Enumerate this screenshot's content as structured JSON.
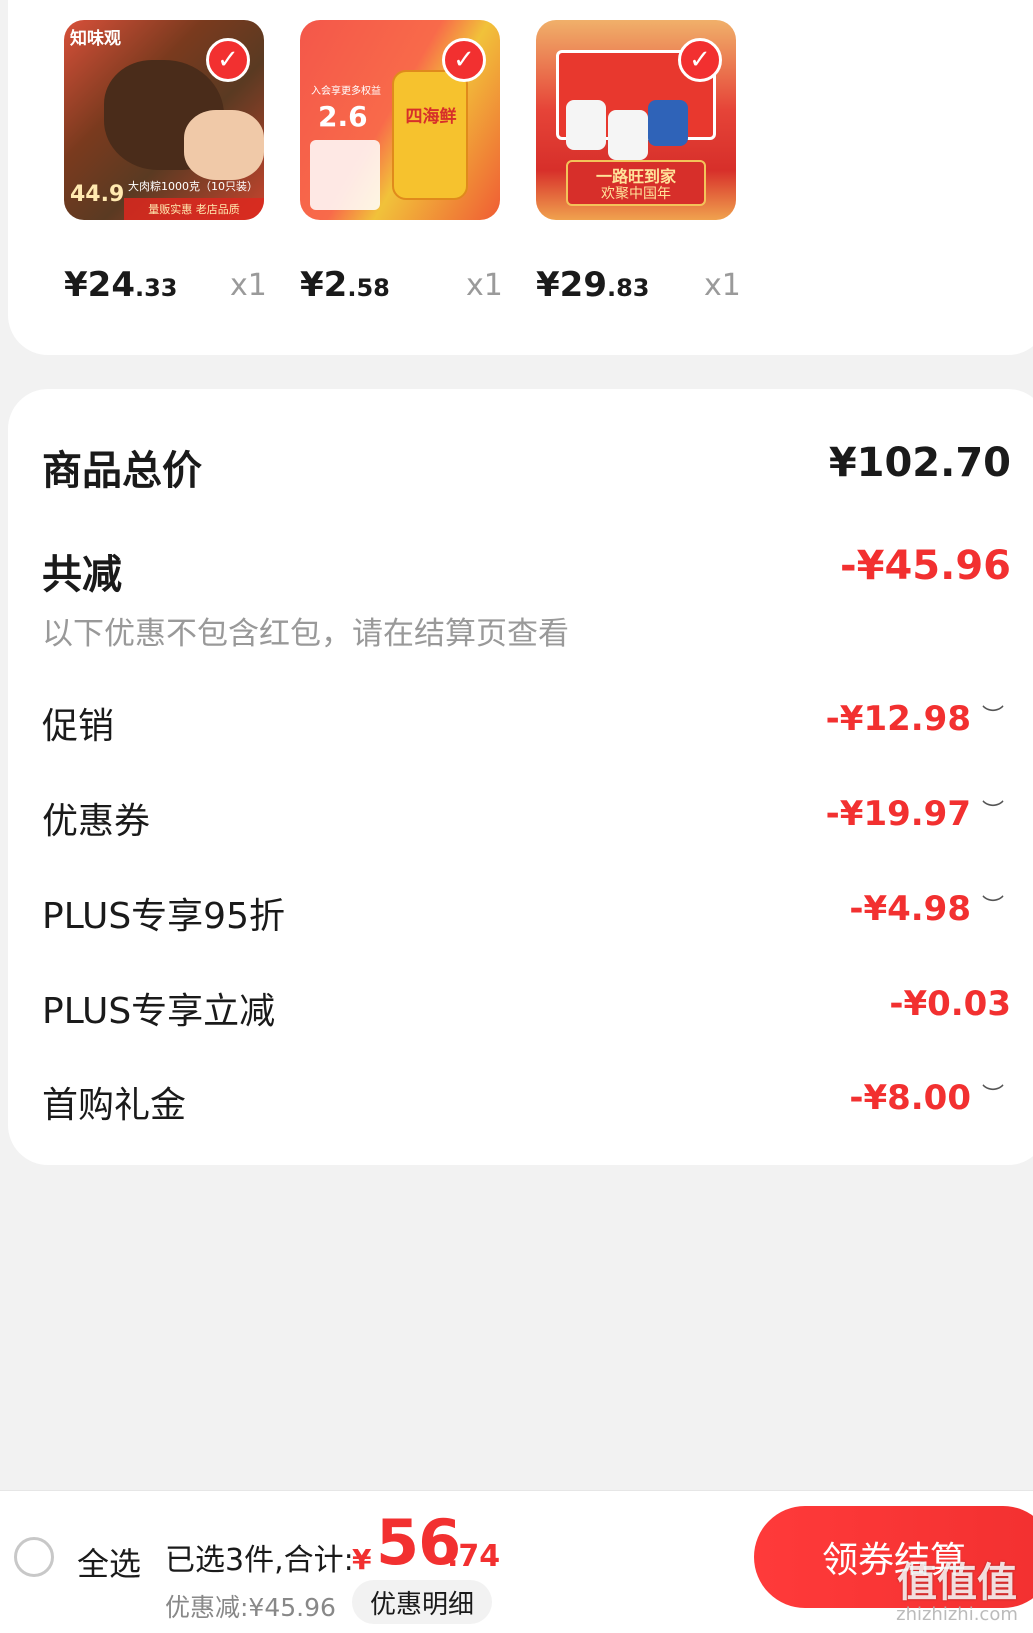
{
  "products": [
    {
      "image_tag": "量贩实惠 老店品质",
      "image_text": "大肉粽1000克（10只装）",
      "image_price": "44.9",
      "price_int": "¥24",
      "price_dec": ".33",
      "qty": "x1"
    },
    {
      "image_tag": "四海鲜",
      "image_text": "入会享更多权益",
      "image_price": "2.6",
      "price_int": "¥2",
      "price_dec": ".58",
      "qty": "x1"
    },
    {
      "image_tag": "一路旺到家",
      "image_text": "欢聚中国年",
      "image_price": "",
      "price_int": "¥29",
      "price_dec": ".83",
      "qty": "x1"
    }
  ],
  "summary": {
    "total_label": "商品总价",
    "total_value": "¥102.70",
    "discount_label": "共减",
    "discount_value": "-¥45.96",
    "note": "以下优惠不包含红包，请在结算页查看",
    "rows": [
      {
        "label": "促销",
        "value": "-¥12.98"
      },
      {
        "label": "优惠券",
        "value": "-¥19.97"
      },
      {
        "label": "PLUS专享95折",
        "value": "-¥4.98"
      },
      {
        "label": "PLUS专享立减",
        "value": "-¥0.03"
      },
      {
        "label": "首购礼金",
        "value": "-¥8.00"
      }
    ]
  },
  "bottom": {
    "select_all": "全选",
    "selected_count": "已选3件,合计:",
    "total_yen": "¥",
    "total_int": "56",
    "total_dec": ".74",
    "saved": "优惠减:¥45.96",
    "detail_button": "优惠明细",
    "checkout_button": "领券结算"
  },
  "watermark": {
    "main": "值值值",
    "sub": "zhizhizhi.com"
  },
  "colors": {
    "accent": "#f23030",
    "background": "#f2f2f2"
  }
}
